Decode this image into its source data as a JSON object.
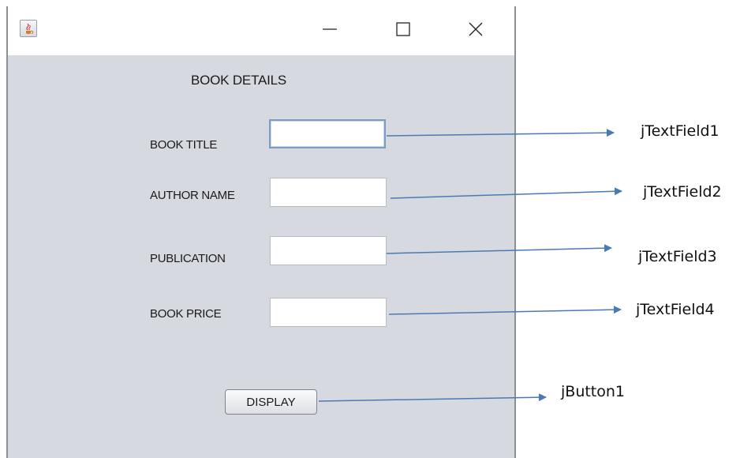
{
  "window": {
    "controls": {
      "minimize_icon": "minimize-icon",
      "maximize_icon": "maximize-icon",
      "close_icon": "close-icon"
    }
  },
  "form": {
    "heading": "BOOK DETAILS",
    "fields": [
      {
        "label": "BOOK TITLE",
        "value": "",
        "focused": true
      },
      {
        "label": "AUTHOR NAME",
        "value": "",
        "focused": false
      },
      {
        "label": "PUBLICATION",
        "value": "",
        "focused": false
      },
      {
        "label": "BOOK PRICE",
        "value": "",
        "focused": false
      }
    ],
    "button_label": "DISPLAY"
  },
  "annotations": {
    "field1": "jTextField1",
    "field2": "jTextField2",
    "field3": "jTextField3",
    "field4": "jTextField4",
    "button": "jButton1"
  },
  "colors": {
    "window_bg": "#d6d9df",
    "arrow": "#4a7ab5",
    "focus_border": "#7a9cc6"
  }
}
